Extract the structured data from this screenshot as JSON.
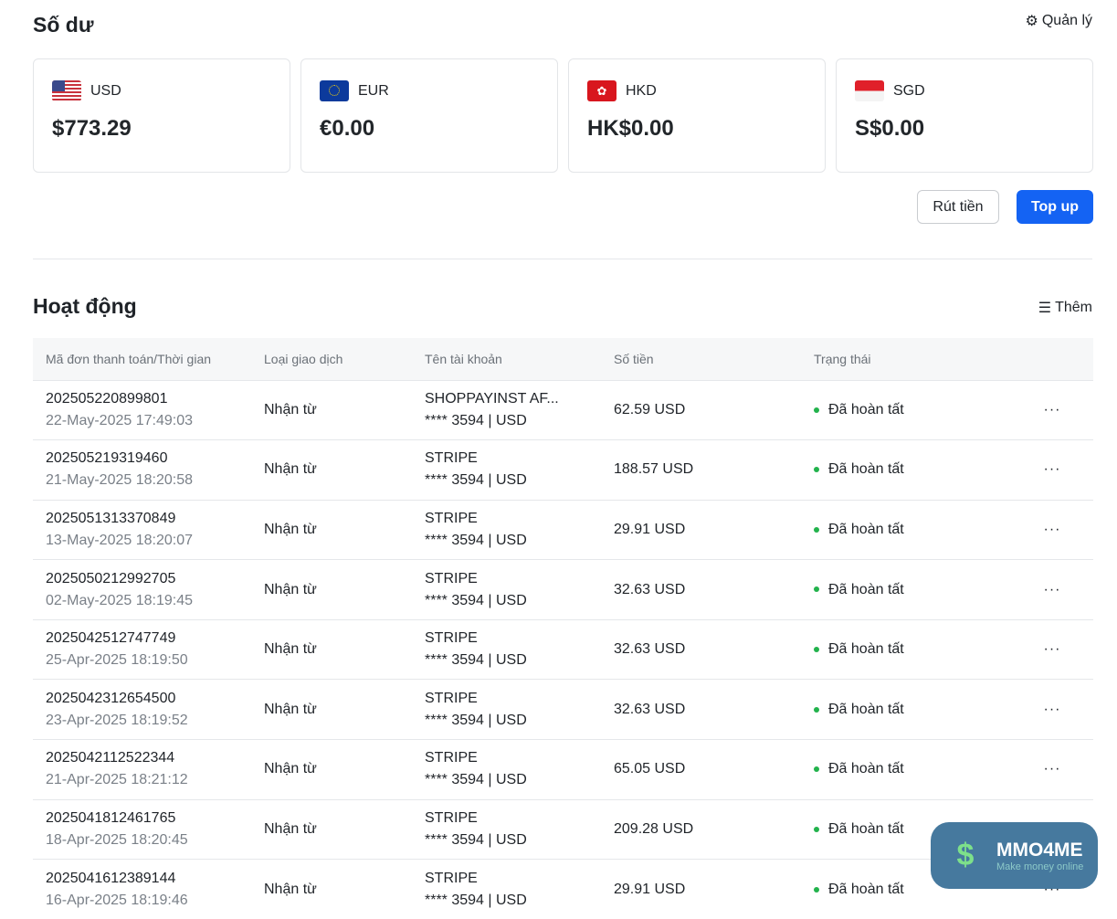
{
  "balance": {
    "title": "Số dư",
    "manage": "Quản lý",
    "cards": [
      {
        "currency": "USD",
        "amount": "$773.29"
      },
      {
        "currency": "EUR",
        "amount": "€0.00"
      },
      {
        "currency": "HKD",
        "amount": "HK$0.00"
      },
      {
        "currency": "SGD",
        "amount": "S$0.00"
      }
    ],
    "withdraw": "Rút tiền",
    "topup": "Top up"
  },
  "activity": {
    "title": "Hoạt động",
    "more": "Thêm",
    "headers": [
      "Mã đơn thanh toán/Thời gian",
      "Loại giao dịch",
      "Tên tài khoản",
      "Số tiền",
      "Trạng thái"
    ],
    "rows": [
      {
        "id": "202505220899801",
        "time": "22-May-2025 17:49:03",
        "type": "Nhận từ",
        "account": "SHOPPAYINST AF...",
        "acct_sub": "**** 3594 | USD",
        "amount": "62.59 USD",
        "status": "Đã hoàn tất"
      },
      {
        "id": "202505219319460",
        "time": "21-May-2025 18:20:58",
        "type": "Nhận từ",
        "account": "STRIPE",
        "acct_sub": "**** 3594 | USD",
        "amount": "188.57 USD",
        "status": "Đã hoàn tất"
      },
      {
        "id": "2025051313370849",
        "time": "13-May-2025 18:20:07",
        "type": "Nhận từ",
        "account": "STRIPE",
        "acct_sub": "**** 3594 | USD",
        "amount": "29.91 USD",
        "status": "Đã hoàn tất"
      },
      {
        "id": "2025050212992705",
        "time": "02-May-2025 18:19:45",
        "type": "Nhận từ",
        "account": "STRIPE",
        "acct_sub": "**** 3594 | USD",
        "amount": "32.63 USD",
        "status": "Đã hoàn tất"
      },
      {
        "id": "2025042512747749",
        "time": "25-Apr-2025 18:19:50",
        "type": "Nhận từ",
        "account": "STRIPE",
        "acct_sub": "**** 3594 | USD",
        "amount": "32.63 USD",
        "status": "Đã hoàn tất"
      },
      {
        "id": "2025042312654500",
        "time": "23-Apr-2025 18:19:52",
        "type": "Nhận từ",
        "account": "STRIPE",
        "acct_sub": "**** 3594 | USD",
        "amount": "32.63 USD",
        "status": "Đã hoàn tất"
      },
      {
        "id": "2025042112522344",
        "time": "21-Apr-2025 18:21:12",
        "type": "Nhận từ",
        "account": "STRIPE",
        "acct_sub": "**** 3594 | USD",
        "amount": "65.05 USD",
        "status": "Đã hoàn tất"
      },
      {
        "id": "2025041812461765",
        "time": "18-Apr-2025 18:20:45",
        "type": "Nhận từ",
        "account": "STRIPE",
        "acct_sub": "**** 3594 | USD",
        "amount": "209.28 USD",
        "status": "Đã hoàn tất"
      },
      {
        "id": "2025041612389144",
        "time": "16-Apr-2025 18:19:46",
        "type": "Nhận từ",
        "account": "STRIPE",
        "acct_sub": "**** 3594 | USD",
        "amount": "29.91 USD",
        "status": "Đã hoàn tất"
      }
    ]
  },
  "watermark": {
    "name": "MMO4ME",
    "tagline": "Make money online"
  },
  "colors": {
    "primary": "#1463f3",
    "success": "#22b24c"
  }
}
